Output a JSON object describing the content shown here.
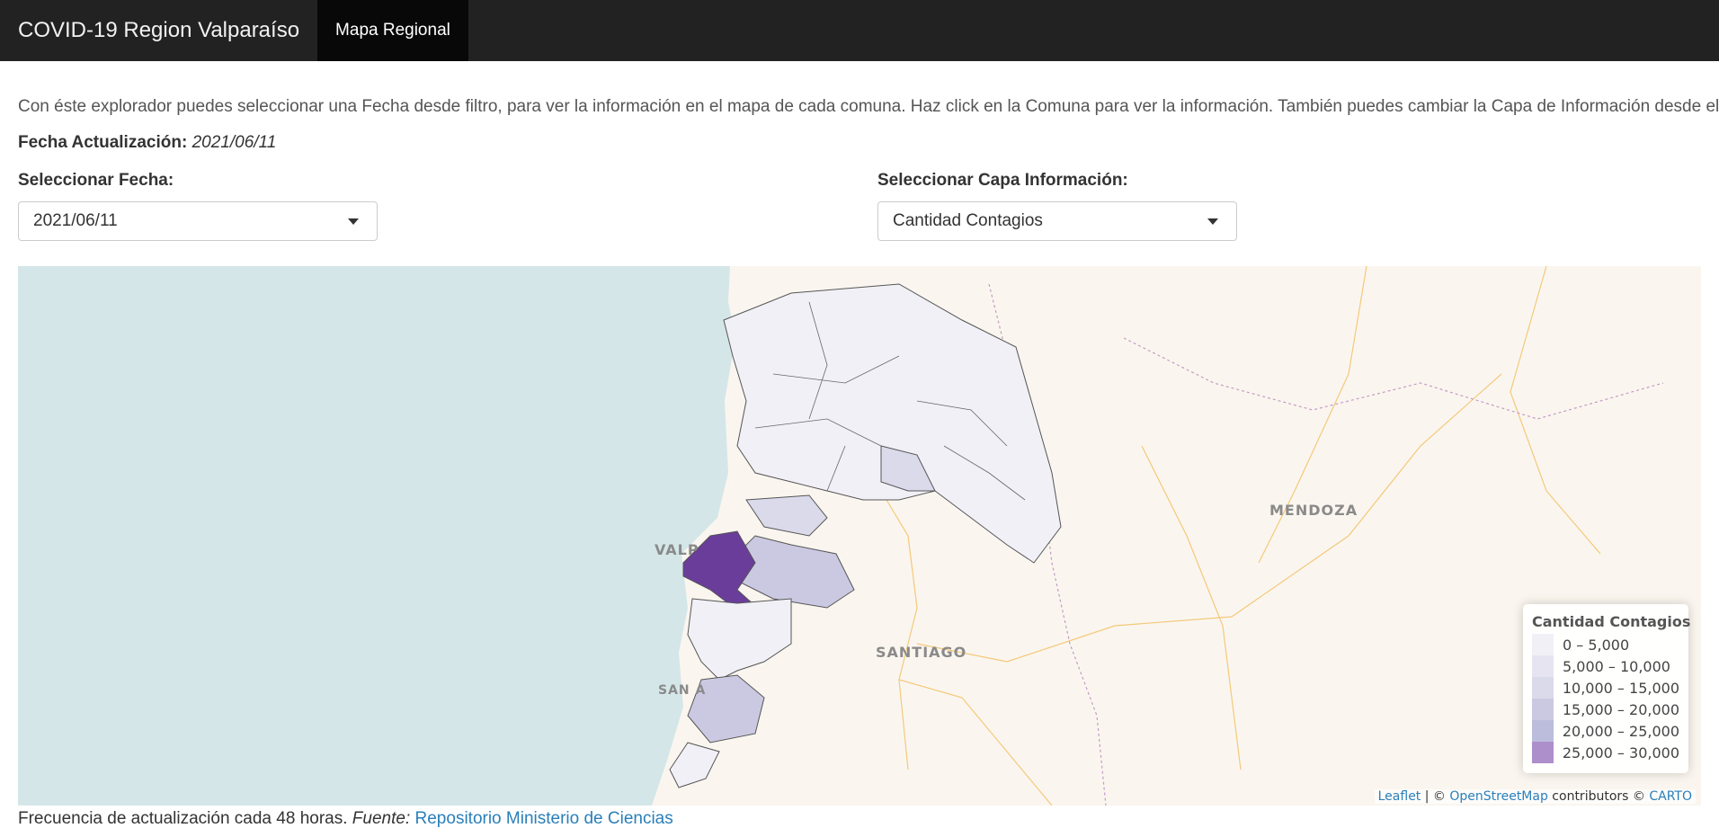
{
  "navbar": {
    "brand": "COVID-19 Region Valparaíso",
    "tab": "Mapa Regional"
  },
  "intro_text": "Con éste explorador puedes seleccionar una Fecha desde filtro, para ver la información en el mapa de cada comuna. Haz click en la Comuna para ver la información. También puedes cambiar la Capa de Información desde el Filtro.",
  "updated": {
    "label": "Fecha Actualización:",
    "value": "2021/06/11"
  },
  "date_filter": {
    "label": "Seleccionar Fecha:",
    "value": "2021/06/11"
  },
  "layer_filter": {
    "label": "Seleccionar Capa Información:",
    "value": "Cantidad Contagios"
  },
  "map": {
    "place_labels": [
      "MENDOZA",
      "VALP",
      "SANTIAGO",
      "SAN A"
    ],
    "legend": {
      "title": "Cantidad Contagios",
      "items": [
        {
          "label": "0 – 5,000",
          "color": "#f2f0f7"
        },
        {
          "label": "5,000 – 10,000",
          "color": "#e6e4f0"
        },
        {
          "label": "10,000 – 15,000",
          "color": "#dadaeb"
        },
        {
          "label": "15,000 – 20,000",
          "color": "#cbc9e2"
        },
        {
          "label": "20,000 – 25,000",
          "color": "#bcbddc"
        },
        {
          "label": "25,000 – 30,000",
          "color": "#ad8fcb"
        }
      ]
    },
    "attribution": {
      "leaflet": "Leaflet",
      "sep": " | © ",
      "osm": "OpenStreetMap",
      "mid": " contributors © ",
      "carto": "CARTO"
    },
    "colors": {
      "ocean": "#d4e6e8",
      "land": "#faf6ef",
      "highlight": "#6a3d9a"
    }
  },
  "footer": {
    "text": "Frecuencia de actualización cada 48 horas.",
    "source_label": "Fuente:",
    "source_link": "Repositorio Ministerio de Ciencias"
  }
}
